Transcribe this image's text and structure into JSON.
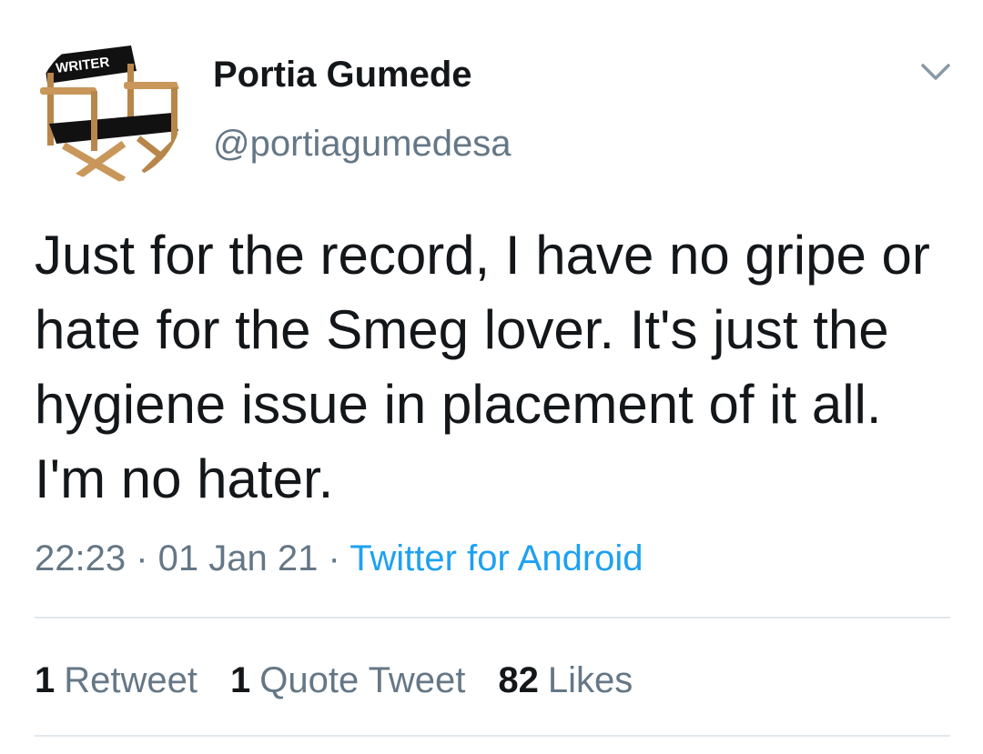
{
  "avatar": {
    "label": "WRITER",
    "icon": "directors-chair-icon"
  },
  "user": {
    "display_name": "Portia Gumede",
    "handle": "@portiagumedesa"
  },
  "menu": {
    "icon": "chevron-down-icon"
  },
  "tweet": {
    "text": "Just for the record, I have no gripe or hate for the Smeg lover. It's just the hygiene issue in placement of it all. I'm no hater.",
    "time": "22:23",
    "separator": " · ",
    "date": "01 Jan 21",
    "source": "Twitter for Android"
  },
  "stats": {
    "retweets_count": "1",
    "retweets_label": "Retweet",
    "quotes_count": "1",
    "quotes_label": "Quote Tweet",
    "likes_count": "82",
    "likes_label": "Likes"
  },
  "colors": {
    "text_primary": "#14171a",
    "text_secondary": "#657786",
    "link": "#1da1f2",
    "divider": "#e1e8ed"
  }
}
